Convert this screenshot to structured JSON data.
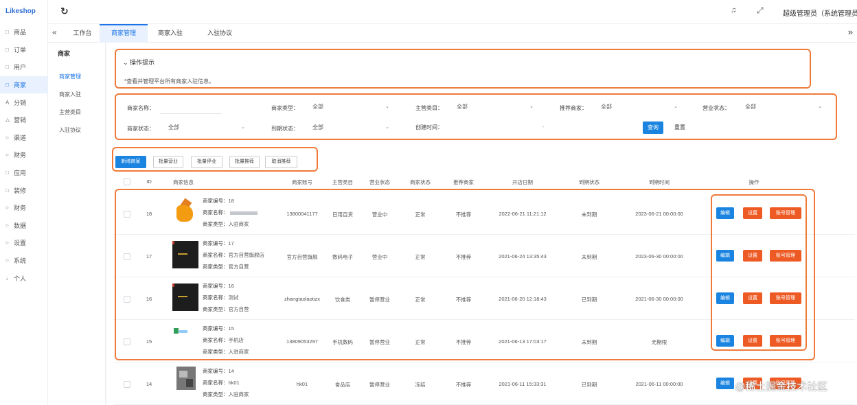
{
  "brand": "Likeshop",
  "nav": [
    {
      "icon": "□",
      "label": "商品"
    },
    {
      "icon": "□",
      "label": "订单"
    },
    {
      "icon": "□",
      "label": "用户"
    },
    {
      "icon": "□",
      "label": "商家"
    },
    {
      "icon": "A",
      "label": "分销"
    },
    {
      "icon": "△",
      "label": "营销"
    },
    {
      "icon": "○",
      "label": "渠道"
    },
    {
      "icon": "○",
      "label": "财务"
    },
    {
      "icon": "□",
      "label": "应用"
    },
    {
      "icon": "□",
      "label": "装修"
    },
    {
      "icon": "○",
      "label": "财务"
    },
    {
      "icon": "○",
      "label": "数据"
    },
    {
      "icon": "○",
      "label": "设置"
    },
    {
      "icon": "○",
      "label": "系统"
    },
    {
      "icon": "↓",
      "label": "个人"
    }
  ],
  "header": {
    "refresh_icon": "↻",
    "bell_icon": "♫",
    "fullscreen_icon": "⤢",
    "user": "超级管理员（系统管理员）"
  },
  "tabs": {
    "back_icon": "«",
    "items": [
      "工作台",
      "商家管理",
      "商家入驻",
      "入驻协议"
    ],
    "more_icon": "»"
  },
  "submenu": {
    "title": "商家",
    "items": [
      "商家管理",
      "商家入驻",
      "主营类目",
      "入驻协议"
    ]
  },
  "tips": {
    "toggle": "⌄ 操作提示",
    "text": "*查看并管理平台所有商家入驻信息。"
  },
  "filters": {
    "row1": [
      {
        "label": "商家名称：",
        "value": ""
      },
      {
        "label": "商家类型：",
        "value": "全部"
      },
      {
        "label": "主营类目：",
        "value": "全部"
      },
      {
        "label": "推荐商家：",
        "value": "全部"
      },
      {
        "label": "营业状态：",
        "value": "全部"
      }
    ],
    "row2": [
      {
        "label": "商家状态：",
        "value": "全部"
      },
      {
        "label": "到期状态：",
        "value": "全部"
      },
      {
        "label": "创建时间：",
        "value": "-"
      }
    ],
    "search": "查询",
    "reset": "重置"
  },
  "actions": [
    "新增商家",
    "批量营业",
    "批量停业",
    "批量推荐",
    "取消推荐"
  ],
  "table": {
    "columns": [
      "ID",
      "商家信息",
      "商家账号",
      "主营类目",
      "营业状态",
      "商家状态",
      "推荐商家",
      "开店日期",
      "到期状态",
      "到期时间",
      "操作"
    ],
    "info_keys": [
      "商家编号：",
      "商家名称：",
      "商家类型："
    ],
    "ops": [
      "编辑",
      "设置",
      "账号管理"
    ],
    "rows": [
      {
        "id": "18",
        "no": "18",
        "name": "",
        "type": "入驻商家",
        "account": "13800041177",
        "category": "日用百货",
        "business": "营业中",
        "status": "正常",
        "recommend": "不推荐",
        "open": "2022-06-21 11:21:12",
        "expire_status": "未到期",
        "expire": "2023-06-21 00:00:00"
      },
      {
        "id": "17",
        "no": "17",
        "name": "官方自营旗舰店",
        "type": "官方自营",
        "account": "官方自营旗舰",
        "category": "数码电子",
        "business": "营业中",
        "status": "正常",
        "recommend": "不推荐",
        "open": "2021-06-24 13:35:43",
        "expire_status": "未到期",
        "expire": "2023-06-30 00:00:00"
      },
      {
        "id": "16",
        "no": "16",
        "name": "测试",
        "type": "官方自营",
        "account": "zhangtaolaotizx",
        "category": "饮食类",
        "business": "暂停营业",
        "status": "正常",
        "recommend": "不推荐",
        "open": "2021-06-20 12:18:43",
        "expire_status": "已到期",
        "expire": "2021-06-30 00:00:00"
      },
      {
        "id": "15",
        "no": "15",
        "name": "手机店",
        "type": "入驻商家",
        "account": "13809053297",
        "category": "手机数码",
        "business": "暂停营业",
        "status": "正常",
        "recommend": "不推荐",
        "open": "2021-06-13 17:03:17",
        "expire_status": "未到期",
        "expire": "无期限"
      },
      {
        "id": "14",
        "no": "14",
        "name": "hk01",
        "type": "入驻商家",
        "account": "hk01",
        "category": "食品店",
        "business": "暂停营业",
        "status": "冻结",
        "recommend": "不推荐",
        "open": "2021-06-11 15:33:31",
        "expire_status": "已到期",
        "expire": "2021-06-11 00:00:00"
      }
    ]
  },
  "watermark": "@稀土掘金技术社区"
}
